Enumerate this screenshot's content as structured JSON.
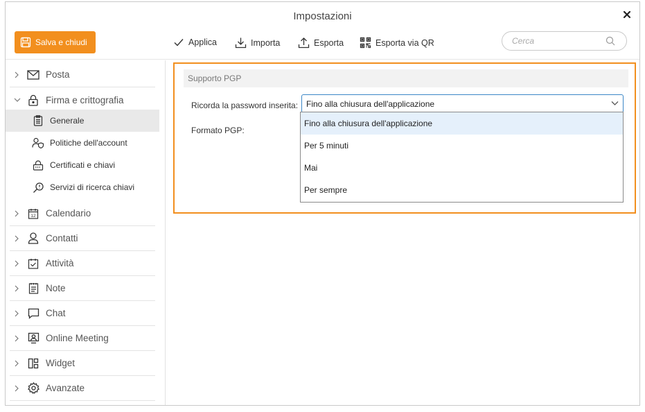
{
  "window": {
    "title": "Impostazioni"
  },
  "toolbar": {
    "save_label": "Salva e chiudi",
    "apply_label": "Applica",
    "import_label": "Importa",
    "export_label": "Esporta",
    "export_qr_label": "Esporta via QR",
    "search_placeholder": "Cerca"
  },
  "sidebar": {
    "mail": "Posta",
    "signature": "Firma e crittografia",
    "sub": {
      "general": "Generale",
      "policies": "Politiche dell'account",
      "certificates": "Certificati e chiavi",
      "key_search": "Servizi di ricerca chiavi"
    },
    "calendar": "Calendario",
    "calendar_day": "12",
    "contacts": "Contatti",
    "tasks": "Attività",
    "notes": "Note",
    "chat": "Chat",
    "meeting": "Online Meeting",
    "widget": "Widget",
    "advanced": "Avanzate"
  },
  "content": {
    "section_title": "Supporto PGP",
    "remember_label": "Ricorda la password inserita:",
    "remember_value": "Fino alla chiusura dell'applicazione",
    "format_label": "Formato PGP:",
    "options": [
      "Fino alla chiusura dell'applicazione",
      "Per 5 minuti",
      "Mai",
      "Per sempre"
    ]
  },
  "colors": {
    "accent": "#f28f1e",
    "focus": "#3b86c6",
    "selected_option": "#e5f0fb"
  }
}
